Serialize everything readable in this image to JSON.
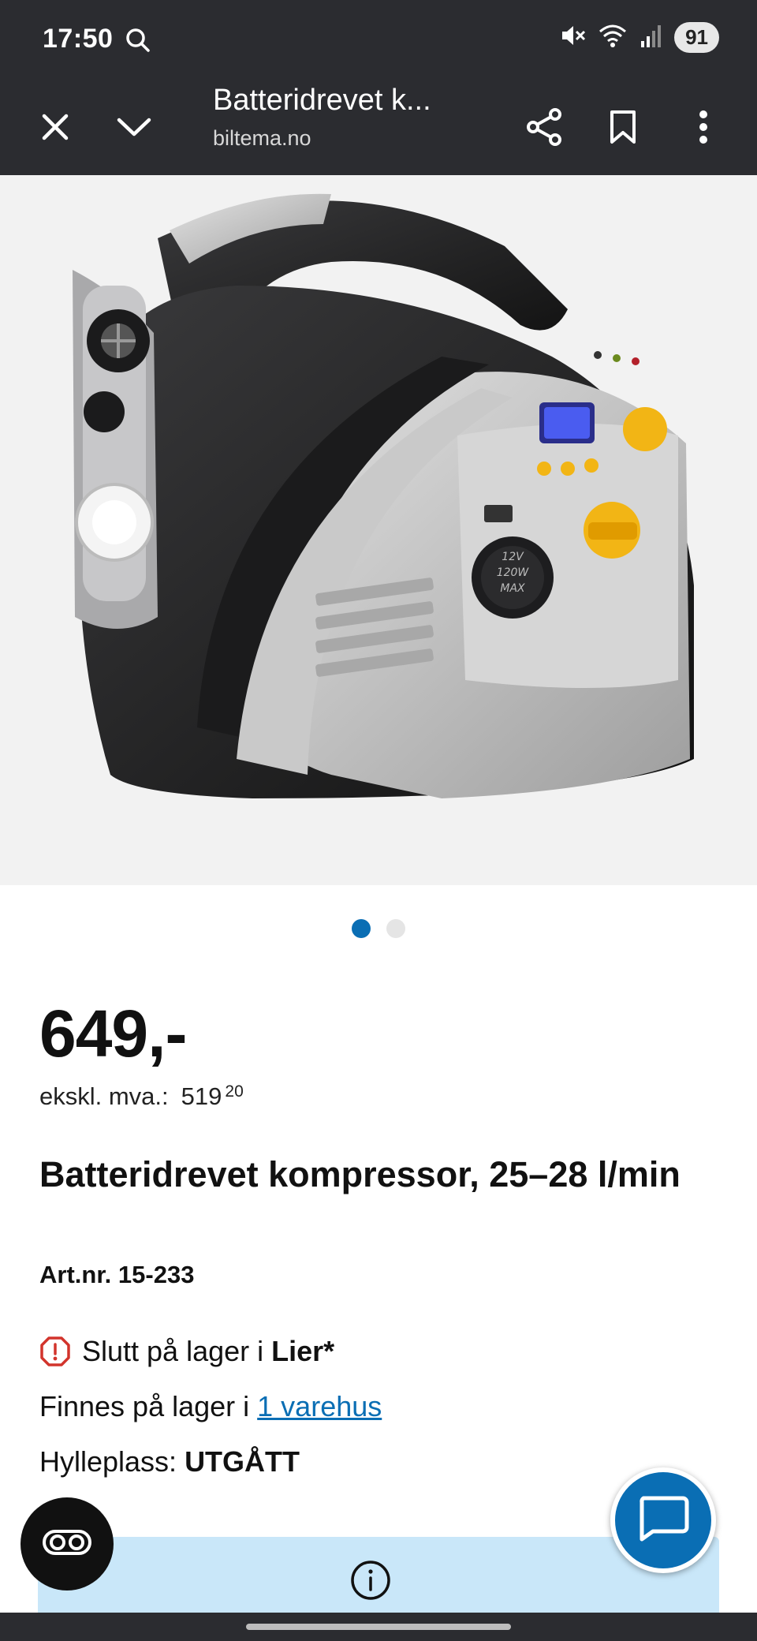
{
  "status_bar": {
    "time": "17:50",
    "battery": "91",
    "icons": [
      "search-icon",
      "mute-icon",
      "wifi-icon",
      "signal-icon"
    ]
  },
  "toolbar": {
    "title": "Batteridrevet k...",
    "domain": "biltema.no",
    "icons": [
      "close-icon",
      "chevron-down-icon",
      "share-icon",
      "bookmark-icon",
      "more-vert-icon"
    ]
  },
  "product_image": {
    "panel_text": "12V\n120W\nMAX",
    "colors": {
      "body": "#2a2a2c",
      "silver": "#c8c8c8",
      "accent": "#f2b515",
      "display": "#4a5cf0"
    }
  },
  "carousel": {
    "count": 2,
    "active": 0
  },
  "product": {
    "price": "649,-",
    "exvat_label": "ekskl. mva.:",
    "exvat_int": "519",
    "exvat_dec": "20",
    "title": "Batteridrevet kompressor, 25–28 l/min",
    "artnr": "Art.nr. 15-233"
  },
  "stock": {
    "out_prefix": "Slutt på lager i ",
    "out_store": "Lier*",
    "available_prefix": "Finnes på lager i",
    "available_link": "1 varehus",
    "shelf_label": "Hylleplass: ",
    "shelf_value": "UTGÅTT"
  },
  "colors": {
    "chrome_bg": "#2b2c30",
    "brand_blue": "#0a6eb4",
    "info_bg": "#c9e7f9",
    "warning_red": "#d2342c"
  }
}
